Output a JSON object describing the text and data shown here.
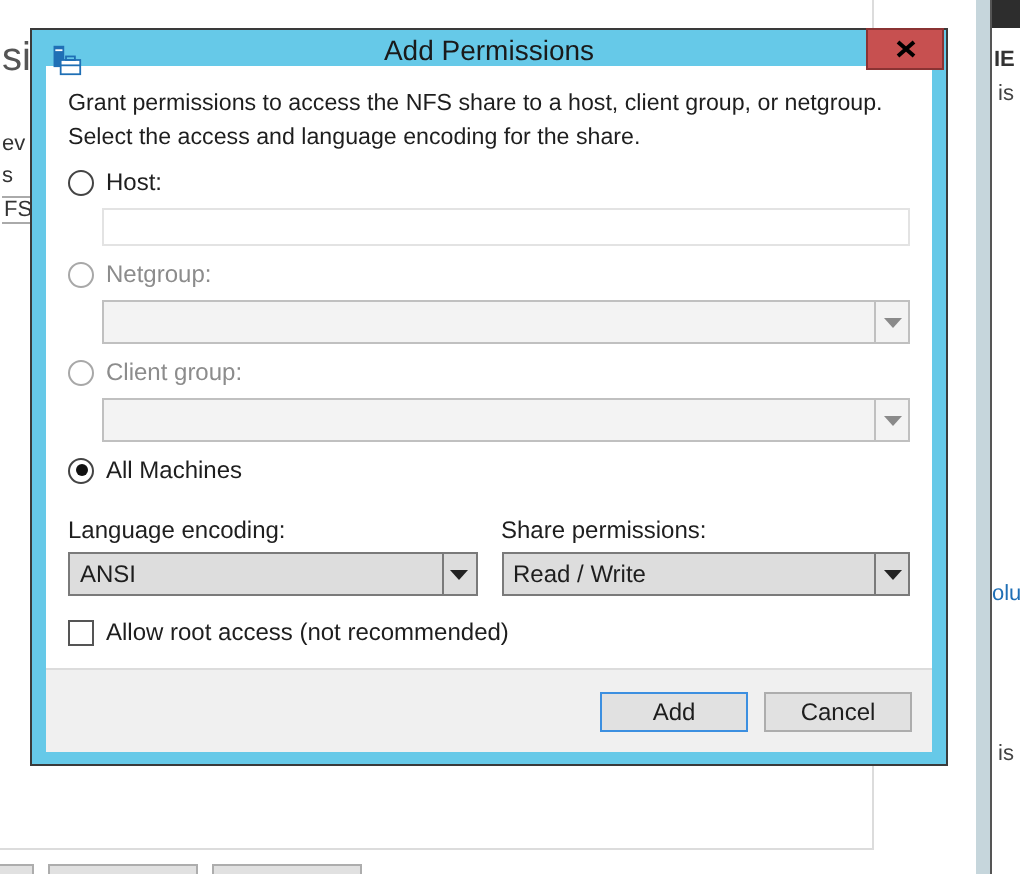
{
  "background": {
    "left_fragments": [
      "si",
      "ev",
      "s",
      "FS"
    ],
    "right_fragments": [
      "IE",
      "is",
      "olu",
      "is"
    ]
  },
  "dialog": {
    "title": "Add Permissions",
    "description": [
      "Grant permissions to access the NFS share to a host, client group, or netgroup.",
      "Select the access and language encoding for the share."
    ],
    "targets": [
      {
        "kind": "text",
        "label": "Host:",
        "selected": false,
        "disabled": false
      },
      {
        "kind": "combo",
        "label": "Netgroup:",
        "selected": false,
        "disabled": true
      },
      {
        "kind": "combo",
        "label": "Client group:",
        "selected": false,
        "disabled": true
      },
      {
        "kind": "none",
        "label": "All Machines",
        "selected": true,
        "disabled": false
      }
    ],
    "language_encoding": {
      "label": "Language encoding:",
      "value": "ANSI"
    },
    "share_permissions": {
      "label": "Share permissions:",
      "value": "Read / Write"
    },
    "root_access": {
      "label": "Allow root access (not recommended)",
      "checked": false
    },
    "buttons": [
      {
        "label": "Add",
        "default": true
      },
      {
        "label": "Cancel",
        "default": false
      }
    ]
  }
}
